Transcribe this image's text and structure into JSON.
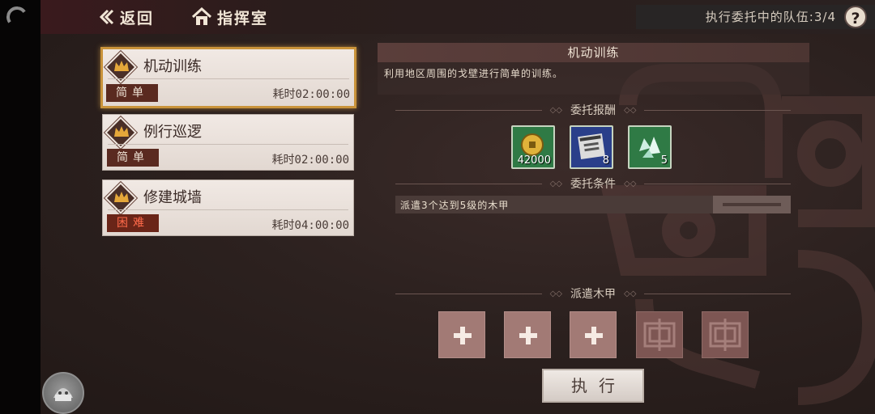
{
  "nav": {
    "back_label": "返回",
    "home_label": "指挥室"
  },
  "queue": {
    "label": "执行委托中的队伍:3/4"
  },
  "help": {
    "label": "?"
  },
  "missions": [
    {
      "title": "机动训练",
      "difficulty": "简单",
      "time": "耗时02:00:00",
      "selected": true
    },
    {
      "title": "例行巡逻",
      "difficulty": "简单",
      "time": "耗时02:00:00",
      "selected": false
    },
    {
      "title": "修建城墙",
      "difficulty": "困难",
      "time": "耗时04:00:00",
      "selected": false
    }
  ],
  "detail": {
    "title": "机动训练",
    "description": "利用地区周围的戈壁进行简单的训练。"
  },
  "rewards": {
    "section_title": "委托报酬",
    "items": [
      {
        "icon": "gold-coin-icon",
        "count": "42000",
        "bg": "#2f7a45"
      },
      {
        "icon": "manual-book-icon",
        "count": "8",
        "bg": "#2a3f8a"
      },
      {
        "icon": "crystal-icon",
        "count": "5",
        "bg": "#2f7a45"
      }
    ]
  },
  "conditions": {
    "section_title": "委托条件",
    "items": [
      {
        "text": "派遣3个达到5级的木甲"
      }
    ]
  },
  "dispatch": {
    "section_title": "派遣木甲",
    "slots": [
      "add",
      "add",
      "add",
      "locked",
      "locked"
    ]
  },
  "execute": {
    "label": "执行"
  },
  "colors": {
    "accent_gold": "#c9933a",
    "hard_text": "#ff6a4a"
  }
}
